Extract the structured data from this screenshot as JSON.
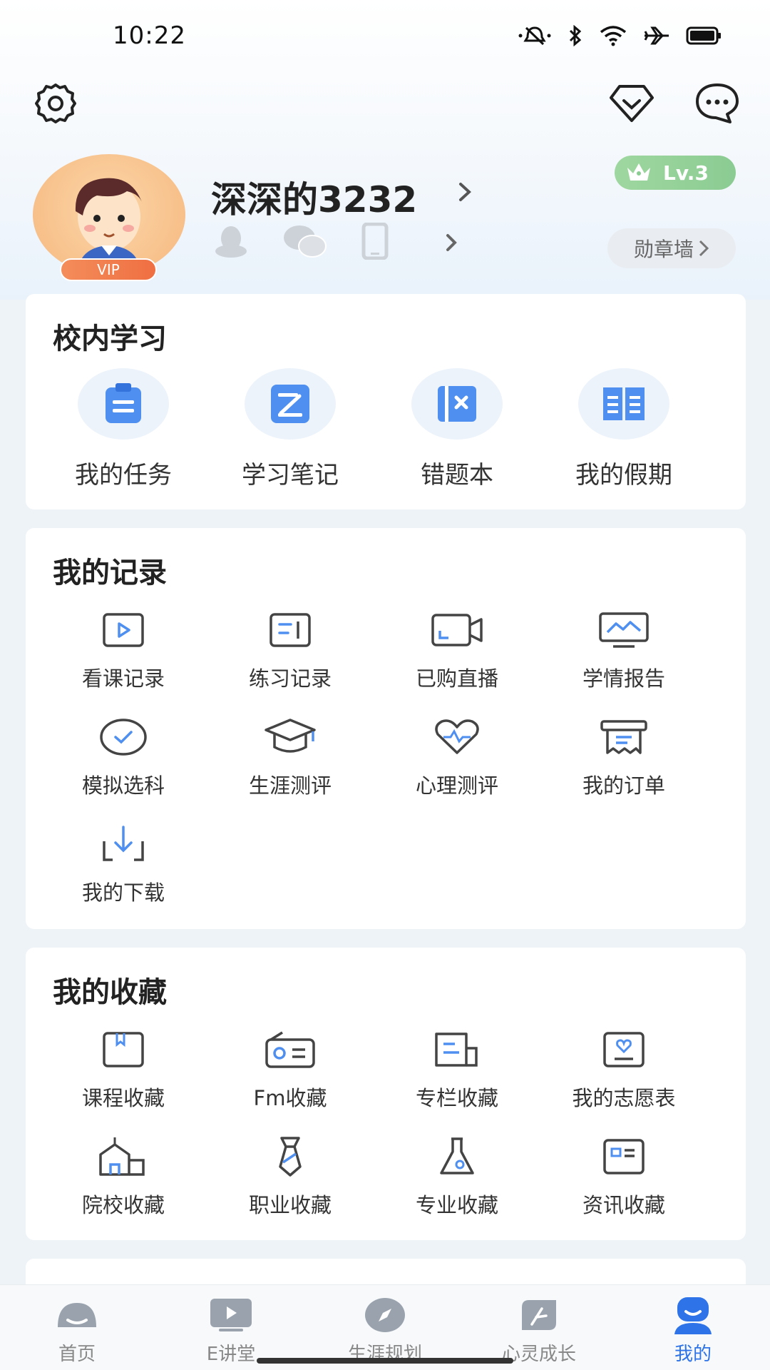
{
  "status_bar": {
    "time": "10:22"
  },
  "top_nav": {
    "settings_icon": "gear-icon",
    "vip_icon": "diamond-icon",
    "message_icon": "chat-icon"
  },
  "profile": {
    "username": "深深的3232",
    "vip_label": "VIP",
    "level": "Lv.3",
    "medal_wall": "勋章墙"
  },
  "school_study": {
    "title": "校内学习",
    "items": [
      {
        "label": "我的任务",
        "icon": "task-icon"
      },
      {
        "label": "学习笔记",
        "icon": "note-icon"
      },
      {
        "label": "错题本",
        "icon": "wrong-book-icon"
      },
      {
        "label": "我的假期",
        "icon": "holiday-book-icon"
      }
    ]
  },
  "my_records": {
    "title": "我的记录",
    "items": [
      {
        "label": "看课记录",
        "icon": "video-record-icon"
      },
      {
        "label": "练习记录",
        "icon": "practice-record-icon"
      },
      {
        "label": "已购直播",
        "icon": "live-camera-icon"
      },
      {
        "label": "学情报告",
        "icon": "report-monitor-icon"
      },
      {
        "label": "模拟选科",
        "icon": "check-circle-icon"
      },
      {
        "label": "生涯测评",
        "icon": "graduation-cap-icon"
      },
      {
        "label": "心理测评",
        "icon": "heart-pulse-icon"
      },
      {
        "label": "我的订单",
        "icon": "receipt-icon"
      },
      {
        "label": "我的下载",
        "icon": "download-icon"
      }
    ]
  },
  "my_favorites": {
    "title": "我的收藏",
    "items": [
      {
        "label": "课程收藏",
        "icon": "course-bookmark-icon"
      },
      {
        "label": "Fm收藏",
        "icon": "radio-icon"
      },
      {
        "label": "专栏收藏",
        "icon": "column-icon"
      },
      {
        "label": "我的志愿表",
        "icon": "wish-list-icon"
      },
      {
        "label": "院校收藏",
        "icon": "school-icon"
      },
      {
        "label": "职业收藏",
        "icon": "necktie-icon"
      },
      {
        "label": "专业收藏",
        "icon": "flask-icon"
      },
      {
        "label": "资讯收藏",
        "icon": "news-card-icon"
      }
    ]
  },
  "tab_bar": {
    "tabs": [
      {
        "label": "首页",
        "icon": "home-icon"
      },
      {
        "label": "E讲堂",
        "icon": "play-screen-icon"
      },
      {
        "label": "生涯规划",
        "icon": "compass-icon"
      },
      {
        "label": "心灵成长",
        "icon": "leaf-icon"
      },
      {
        "label": "我的",
        "icon": "profile-icon"
      }
    ],
    "active": "我的",
    "active_color": "#2f73e8"
  }
}
